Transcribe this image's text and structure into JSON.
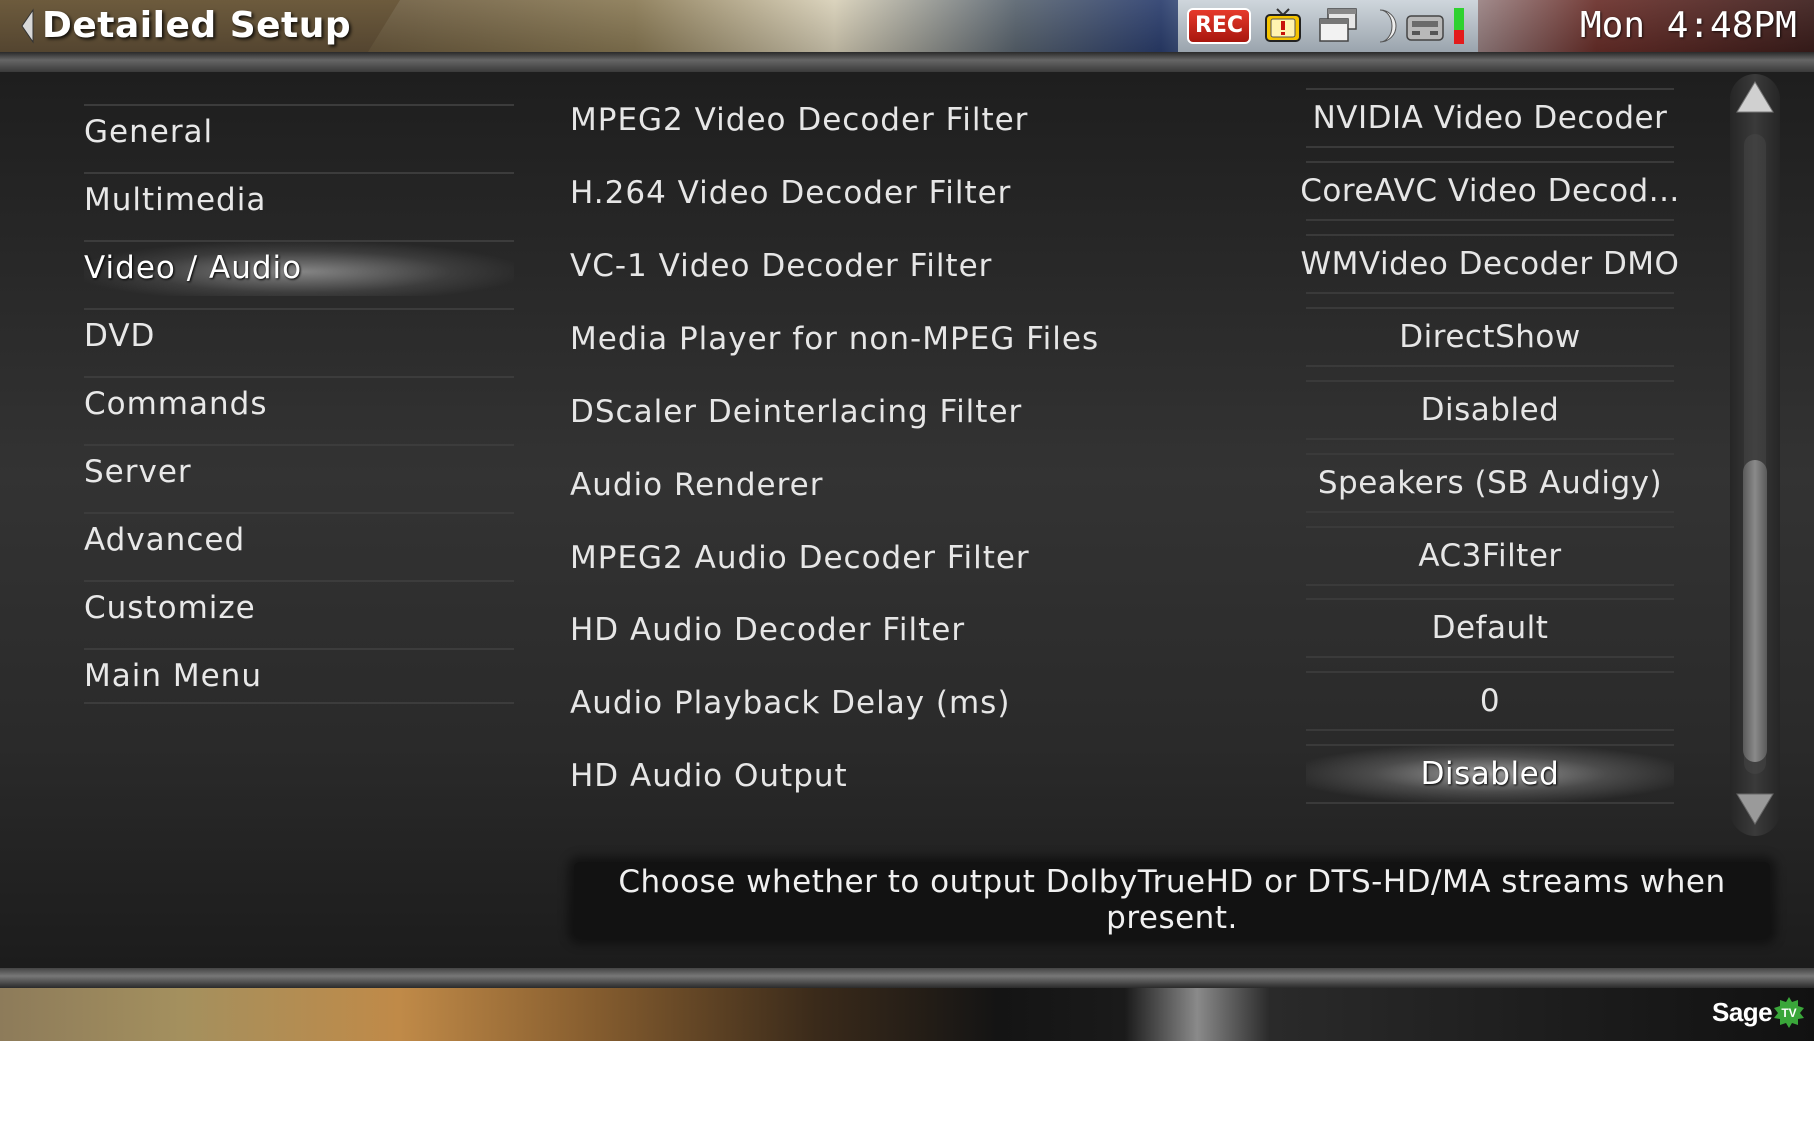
{
  "header": {
    "title": "Detailed Setup",
    "rec_label": "REC",
    "clock": "Mon 4:48PM",
    "tray_icons": [
      "rec-badge",
      "tv-warning-icon",
      "windows-icon",
      "moon-icon",
      "tuner-icon",
      "signal-level-icon"
    ],
    "accent_colors": {
      "rec": "#d8261b",
      "warning": "#f5c400",
      "signal_red": "#e31b1b",
      "signal_green": "#2fd12f"
    }
  },
  "menu": {
    "items": [
      {
        "label": "General"
      },
      {
        "label": "Multimedia"
      },
      {
        "label": "Video / Audio",
        "selected": true
      },
      {
        "label": "DVD"
      },
      {
        "label": "Commands"
      },
      {
        "label": "Server"
      },
      {
        "label": "Advanced"
      },
      {
        "label": "Customize"
      },
      {
        "label": "Main Menu"
      }
    ]
  },
  "settings": {
    "rows": [
      {
        "label": "MPEG2 Video Decoder Filter",
        "value": "NVIDIA Video Decoder"
      },
      {
        "label": "H.264 Video Decoder Filter",
        "value": "CoreAVC Video Decod..."
      },
      {
        "label": "VC-1 Video Decoder Filter",
        "value": "WMVideo Decoder DMO"
      },
      {
        "label": "Media Player for non-MPEG Files",
        "value": "DirectShow"
      },
      {
        "label": "DScaler Deinterlacing Filter",
        "value": "Disabled"
      },
      {
        "label": "Audio Renderer",
        "value": "Speakers (SB Audigy)"
      },
      {
        "label": "MPEG2 Audio Decoder Filter",
        "value": "AC3Filter"
      },
      {
        "label": "HD Audio Decoder Filter",
        "value": "Default"
      },
      {
        "label": "Audio Playback Delay (ms)",
        "value": "0"
      },
      {
        "label": "HD Audio Output",
        "value": "Disabled",
        "selected": true
      }
    ]
  },
  "help": {
    "text": "Choose whether to output DolbyTrueHD or DTS-HD/MA streams when present."
  },
  "footer": {
    "logo_text": "Sage",
    "logo_badge": "TV",
    "logo_badge_color": "#3aa63a"
  }
}
